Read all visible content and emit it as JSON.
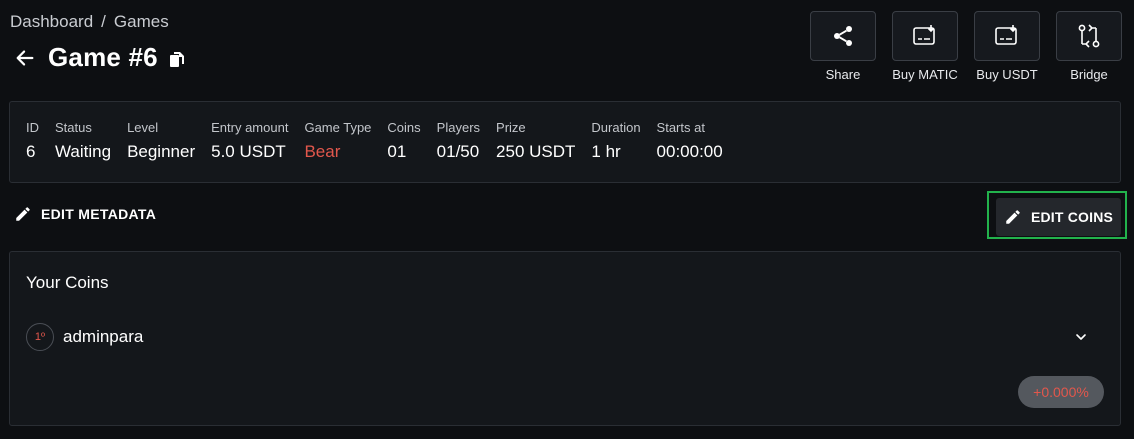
{
  "breadcrumb": {
    "root": "Dashboard",
    "separator": "/",
    "current": "Games"
  },
  "header": {
    "title": "Game #6",
    "back_icon": "arrow-left-icon",
    "copy_icon": "copy-icon"
  },
  "actions": [
    {
      "label": "Share",
      "icon": "share-icon"
    },
    {
      "label": "Buy MATIC",
      "icon": "buy-icon"
    },
    {
      "label": "Buy USDT",
      "icon": "buy-icon"
    },
    {
      "label": "Bridge",
      "icon": "bridge-icon"
    }
  ],
  "info": {
    "id": {
      "key": "ID",
      "value": "6"
    },
    "status": {
      "key": "Status",
      "value": "Waiting"
    },
    "level": {
      "key": "Level",
      "value": "Beginner"
    },
    "entry": {
      "key": "Entry amount",
      "value": "5.0 USDT"
    },
    "type": {
      "key": "Game Type",
      "value": "Bear"
    },
    "coins": {
      "key": "Coins",
      "value": "01"
    },
    "players": {
      "key": "Players",
      "value": "01/50"
    },
    "prize": {
      "key": "Prize",
      "value": "250 USDT"
    },
    "duration": {
      "key": "Duration",
      "value": "1 hr"
    },
    "starts": {
      "key": "Starts at",
      "value": "00:00:00"
    }
  },
  "edit": {
    "metadata_label": "EDIT METADATA",
    "coins_label": "EDIT COINS"
  },
  "your_coins": {
    "title": "Your Coins",
    "rows": [
      {
        "rank": "1º",
        "user": "adminpara",
        "change": "+0.000%"
      }
    ]
  },
  "colors": {
    "accent_red": "#e2574c",
    "highlight_green": "#22b24c",
    "background": "#0d0f12"
  }
}
